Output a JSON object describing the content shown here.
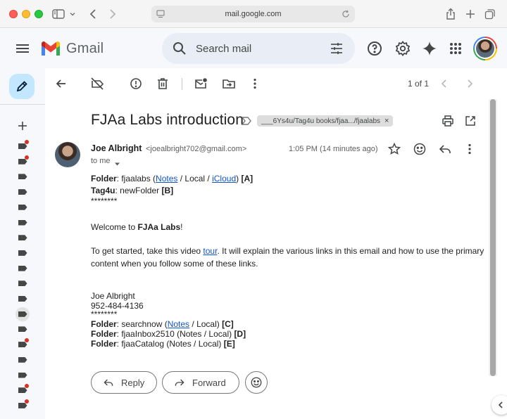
{
  "browser": {
    "url": "mail.google.com"
  },
  "gmail": {
    "logo_text": "Gmail",
    "search_placeholder": "Search mail"
  },
  "toolbar": {
    "pager_text": "1 of 1"
  },
  "email": {
    "subject": "FJAa Labs introduction",
    "label_chip": "___6Ys4u/Tag4u books/fjaa.../fjaalabs",
    "sender_name": "Joe Albright",
    "sender_email": "<joealbright702@gmail.com>",
    "to": "to me",
    "timestamp": "1:05 PM (14 minutes ago)",
    "body": {
      "folder_label": "Folder",
      "folder_prefix": ": fjaalabs (",
      "notes_link": "Notes",
      "folder_mid": " / Local / ",
      "icloud_link": "iCloud",
      "folder_suffix": ") ",
      "folder_ref": "[A]",
      "tag4u_label": "Tag4u",
      "tag4u_value": ": newFolder ",
      "tag4u_ref": "[B]",
      "stars1": "********",
      "welcome_prefix": "Welcome to ",
      "welcome_bold": "FJAa Labs",
      "welcome_suffix": "!",
      "para_prefix": "To get started, take this video ",
      "tour_link": "tour",
      "para_suffix": ". It will explain the various links in this email and how to use the primary content when you follow some of these links.",
      "sig_name": "Joe Albright",
      "sig_phone": "952-484-4136",
      "stars2": "********",
      "f1_label": "Folder",
      "f1_prefix": ": searchnow  (",
      "f1_link": "Notes",
      "f1_mid": " / Local) ",
      "f1_ref": "[C]",
      "f2_label": "Folder",
      "f2_text": ": fjaaInbox2510 (Notes  / Local) ",
      "f2_ref": "[D]",
      "f3_label": "Folder",
      "f3_text": ": fjaaCatalog (Notes  / Local) ",
      "f3_ref": "[E]"
    }
  },
  "actions": {
    "reply": "Reply",
    "forward": "Forward"
  },
  "labels_rail": [
    {
      "dot": true
    },
    {
      "dot": true
    },
    {
      "dot": false
    },
    {
      "dot": false
    },
    {
      "dot": false
    },
    {
      "dot": false
    },
    {
      "dot": false
    },
    {
      "dot": false
    },
    {
      "dot": false
    },
    {
      "dot": false
    },
    {
      "dot": false
    },
    {
      "dot": false,
      "active": true
    },
    {
      "dot": false
    },
    {
      "dot": true
    },
    {
      "dot": false
    },
    {
      "dot": false
    },
    {
      "dot": true
    },
    {
      "dot": true
    }
  ],
  "colors": {
    "accent_blue": "#1155cc",
    "compose_bg": "#c2e7ff",
    "label_dot": "#d93025"
  }
}
